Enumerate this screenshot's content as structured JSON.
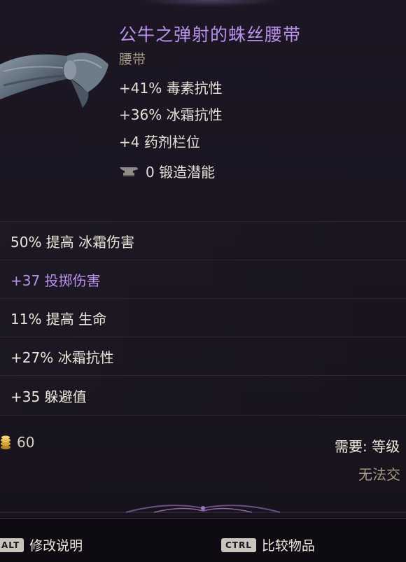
{
  "item": {
    "name": "公牛之弹射的蛛丝腰带",
    "type": "腰带",
    "implicits": [
      "+41% 毒素抗性",
      "+36% 冰霜抗性",
      "+4 药剂栏位"
    ],
    "forge_potential": "0 锻造潜能"
  },
  "affixes": [
    {
      "text": "50% 提高 冰霜伤害",
      "special": false
    },
    {
      "text": "+37 投掷伤害",
      "special": true
    },
    {
      "text": "11% 提高 生命",
      "special": false
    },
    {
      "text": "+27% 冰霜抗性",
      "special": false
    },
    {
      "text": "+35 躲避值",
      "special": false
    }
  ],
  "footer": {
    "gold_value": "60",
    "requirement": "需要: 等级",
    "tradeable": "无法交"
  },
  "commands": {
    "alt_key": "ALT",
    "alt_label": "修改说明",
    "ctrl_key": "CTRL",
    "ctrl_label": "比较物品"
  },
  "colors": {
    "item_name": "#b892ea",
    "special_affix": "#b892ea",
    "subtle_text": "#a69a84",
    "panel_bg": "#1a1521"
  },
  "icons": {
    "item_art": "spider-silk-belt-icon",
    "forge": "anvil-icon",
    "gold": "gold-coins-icon"
  }
}
